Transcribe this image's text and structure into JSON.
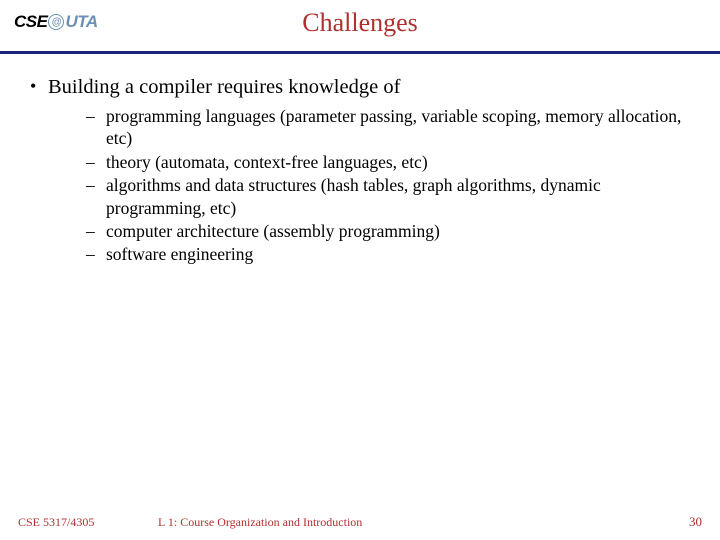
{
  "logo": {
    "left": "CSE",
    "right": "UTA"
  },
  "title": "Challenges",
  "bullet": {
    "main": "Building a compiler requires knowledge of",
    "items": [
      "programming languages (parameter passing, variable scoping, memory allocation, etc)",
      "theory (automata, context-free languages, etc)",
      "algorithms and data structures (hash tables, graph algorithms, dynamic programming, etc)",
      "computer architecture (assembly programming)",
      "software engineering"
    ]
  },
  "footer": {
    "course": "CSE 5317/4305",
    "lecture": "L 1: Course Organization and Introduction",
    "page": "30"
  }
}
